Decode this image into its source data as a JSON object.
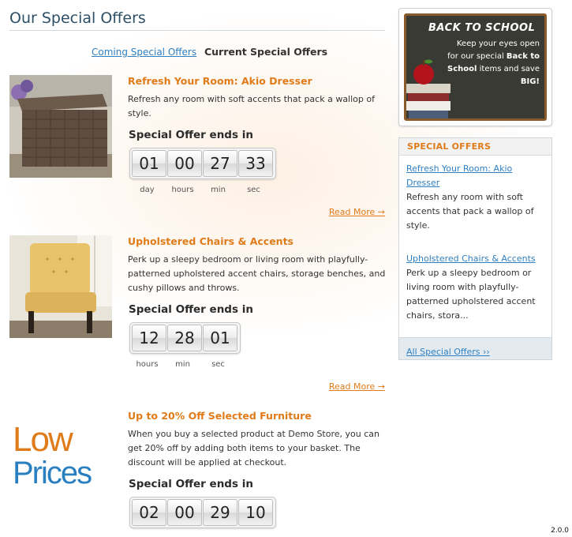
{
  "page": {
    "title": "Our Special Offers",
    "version": "2.0.0"
  },
  "tabs": {
    "coming": "Coming Special Offers",
    "current": "Current Special Offers"
  },
  "offers": [
    {
      "title": "Refresh Your Room: Akio Dresser",
      "description": "Refresh any room with soft accents that pack a wallop of style.",
      "ends_label": "Special Offer ends in",
      "timer": [
        "01",
        "00",
        "27",
        "33"
      ],
      "timer_labels": [
        "day",
        "hours",
        "min",
        "sec"
      ],
      "read_more": "Read More →"
    },
    {
      "title": "Upholstered Chairs & Accents",
      "description": "Perk up a sleepy bedroom or living room with playfully-patterned upholstered accent chairs, storage benches, and cushy pillows and throws.",
      "ends_label": "Special Offer ends in",
      "timer": [
        "12",
        "28",
        "01"
      ],
      "timer_labels": [
        "hours",
        "min",
        "sec"
      ],
      "read_more": "Read More →"
    },
    {
      "title": "Up to 20% Off Selected Furniture",
      "description": "When you buy a selected product at Demo Store, you can get 20% off by adding both items to your basket. The discount will be applied at checkout.",
      "ends_label": "Special Offer ends in",
      "timer": [
        "02",
        "00",
        "29",
        "10"
      ],
      "image_text": {
        "line1": "Low",
        "line2": "Prices"
      }
    }
  ],
  "promo": {
    "heading": "BACK TO SCHOOL",
    "text_1": "Keep your eyes open for our special ",
    "text_bold_1": "Back to School",
    "text_2": " items and save ",
    "text_bold_2": "BIG!"
  },
  "sidebar": {
    "heading": "SPECIAL OFFERS",
    "items": [
      {
        "link": "Refresh Your Room: Akio Dresser",
        "text": "Refresh any room with soft accents that pack a wallop of style."
      },
      {
        "link": "Upholstered Chairs & Accents",
        "text": "Perk up a sleepy bedroom or living room with playfully-patterned upholstered accent chairs, stora..."
      }
    ],
    "all_link": "All Special Offers ››"
  },
  "colors": {
    "accent_orange": "#e07b1a",
    "link_blue": "#2f7fc1",
    "title_blue": "#2d4f66"
  }
}
